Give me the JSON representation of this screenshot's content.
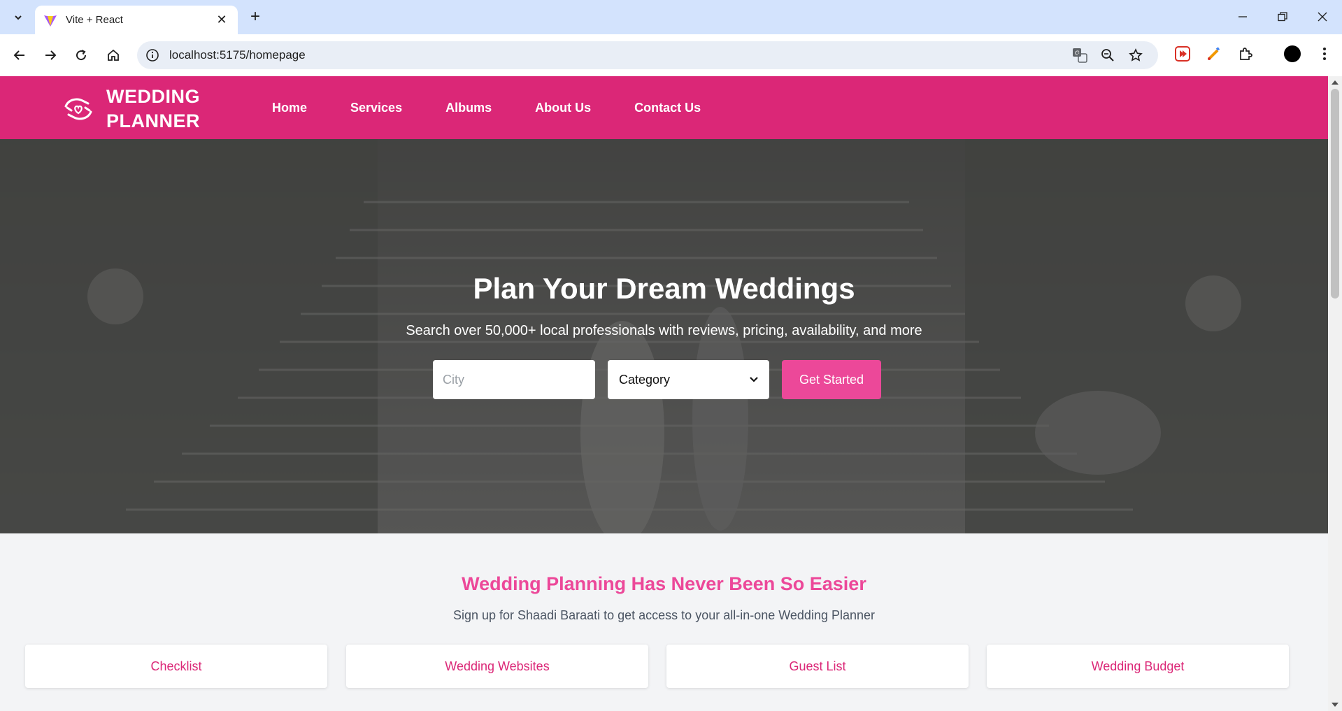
{
  "browser": {
    "tab_title": "Vite + React",
    "url": "localhost:5175/homepage"
  },
  "site": {
    "logo_line1": "WEDDING",
    "logo_line2": "PLANNER",
    "nav": [
      "Home",
      "Services",
      "Albums",
      "About Us",
      "Contact Us"
    ],
    "brand_color": "#db2777",
    "accent_color": "#ec4899"
  },
  "hero": {
    "title": "Plan Your Dream Weddings",
    "subtitle": "Search over 50,000+ local professionals with reviews, pricing, availability, and more",
    "city_placeholder": "City",
    "category_value": "Category",
    "cta_label": "Get Started"
  },
  "planning": {
    "title": "Wedding Planning Has Never Been So Easier",
    "subtitle": "Sign up for Shaadi Baraati to get access to your all-in-one Wedding Planner",
    "cards": [
      "Checklist",
      "Wedding Websites",
      "Guest List",
      "Wedding Budget"
    ]
  }
}
